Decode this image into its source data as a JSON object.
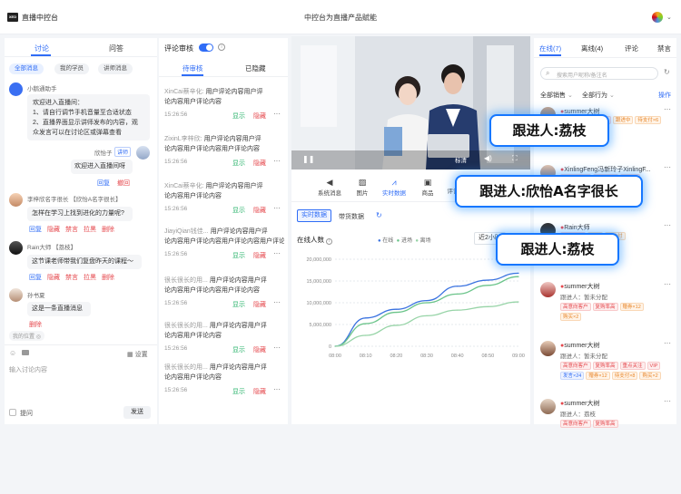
{
  "header": {
    "logo": "XED",
    "app_title": "直播中控台",
    "center_title": "中控台为直播产品赋能"
  },
  "left_panel": {
    "tabs": [
      {
        "label": "讨论"
      },
      {
        "label": "问答"
      }
    ],
    "filters": [
      {
        "label": "全部消息"
      },
      {
        "label": "我的学员"
      },
      {
        "label": "讲师消息"
      }
    ],
    "assistant": {
      "name": "小鹅通助手",
      "lines": [
        "欢迎进入直播间：",
        "1、请自行调节手机音量至合适状态",
        "2、直播界面显示讲师发布的内容，观",
        "众发言可以在讨论区或弹幕查看"
      ]
    },
    "self_msg": {
      "name": "欣怡子",
      "badge": "讲师",
      "text": "欢迎进入直播间呀",
      "actions": [
        "回复",
        "撤回"
      ]
    },
    "messages": [
      {
        "name": "李梓欣名字很长 【欣怡A名字很长】",
        "text": "怎样在学习上找到进化的力量呢?",
        "actions": [
          "回复",
          "隐藏",
          "禁言",
          "拉黑",
          "删除"
        ]
      },
      {
        "name": "Rain大师 【荔枝】",
        "text": "这节课老师带我们复盘昨天的课程～",
        "actions": [
          "回复",
          "隐藏",
          "禁言",
          "拉黑",
          "删除"
        ]
      },
      {
        "name": "孙书夏",
        "text": "这是一条直播消息",
        "actions": [
          "删除"
        ]
      }
    ],
    "my_position": "我的位置",
    "input_placeholder": "输入讨论内容",
    "settings_label": "设置",
    "prompt_label": "提问",
    "send_label": "发送"
  },
  "review_panel": {
    "title": "评论审核",
    "tabs": [
      {
        "label": "待审核"
      },
      {
        "label": "已隐藏"
      }
    ],
    "items": [
      {
        "name": "XinCai蔡辛化:",
        "text_a": "用户评论内容用户评",
        "text_b": "论内容用户评论内容",
        "time": "15:26:56",
        "show": "显示",
        "hide": "隐藏"
      },
      {
        "name": "ZixinL李梓欣:",
        "text_a": "用户评论内容用户评",
        "text_b": "论内容用户评论内容用户评论内容",
        "time": "15:26:56",
        "show": "显示",
        "hide": "隐藏"
      },
      {
        "name": "XinCai蔡辛化:",
        "text_a": "用户评论内容用户评",
        "text_b": "论内容用户评论内容",
        "time": "15:26:56",
        "show": "显示",
        "hide": "隐藏"
      },
      {
        "name": "JiayiQian钱佳...",
        "text_a": "用户评论内容用户评",
        "text_b": "论内容用户评论内容用户评论内容用户评论内容用户评论内容好呢？",
        "time": "15:26:56",
        "show": "显示",
        "hide": "隐藏"
      },
      {
        "name": "很长很长的用...",
        "text_a": "用户评论内容用户评",
        "text_b": "论内容用户评论内容用户评论内容",
        "time": "15:26:56",
        "show": "显示",
        "hide": "隐藏"
      },
      {
        "name": "很长很长的用...",
        "text_a": "用户评论内容用户评",
        "text_b": "论内容用户评论内容",
        "time": "15:26:56",
        "show": "显示",
        "hide": "隐藏"
      },
      {
        "name": "很长很长的用...",
        "text_a": "用户评论内容用户评",
        "text_b": "论内容用户评论内容",
        "time": "15:26:56",
        "show": "显示",
        "hide": "隐藏"
      }
    ]
  },
  "video": {
    "resolution": "标清"
  },
  "toolbar": {
    "items": [
      {
        "label": "系统消息"
      },
      {
        "label": "图片"
      },
      {
        "label": "实时数据"
      },
      {
        "label": "商品"
      },
      {
        "label": "评论"
      }
    ]
  },
  "data_tabs": [
    {
      "label": "实时数据"
    },
    {
      "label": "带货数据"
    }
  ],
  "chart_data": {
    "type": "line",
    "title": "在线人数",
    "legend": [
      "在线",
      "进场",
      "离场"
    ],
    "legend_position": "top-right",
    "range_label": "近2小时",
    "x": [
      "08:00",
      "08:10",
      "08:20",
      "08:30",
      "08:40",
      "08:50",
      "09:00"
    ],
    "y_ticks": [
      "20,000,000",
      "15,000,000",
      "10,000,000",
      "5,000,000",
      "0"
    ],
    "ylim": [
      0,
      20000000
    ],
    "series": [
      {
        "name": "在线",
        "color": "#3b73e0",
        "values": [
          0,
          6500000,
          8500000,
          10500000,
          13800000,
          15200000,
          16800000
        ]
      },
      {
        "name": "进场",
        "color": "#6bc48a",
        "values": [
          0,
          5200000,
          7800000,
          10000000,
          12000000,
          14000000,
          16000000
        ]
      },
      {
        "name": "离场",
        "color": "#97d4a7",
        "values": [
          0,
          2500000,
          4800000,
          7000000,
          8300000,
          9100000,
          10200000
        ]
      }
    ],
    "grid": true
  },
  "right_panel": {
    "tabs": [
      {
        "label": "在线(7)"
      },
      {
        "label": "离线(4)"
      },
      {
        "label": "评论"
      },
      {
        "label": "禁言"
      }
    ],
    "search_placeholder": "搜索用户昵称/备注名",
    "filter_sales": "全部销售",
    "filter_all": "全部行为",
    "operate_label": "操作",
    "users": [
      {
        "name": "summer大树",
        "sub": "",
        "tags": [
          [
            "重点关注",
            "red"
          ],
          [
            "VIP客户",
            "red"
          ],
          [
            "跟进中",
            "orange"
          ],
          [
            "待支付×6",
            "orange"
          ],
          [
            "购买×2",
            "orange"
          ]
        ]
      },
      {
        "name": "XinlingFeng冯新玲子XinlingF...",
        "sub": "",
        "tags": [
          [
            "高意向客户",
            "red"
          ],
          [
            "发起询价",
            "red"
          ],
          [
            "未付款",
            "red"
          ],
          [
            "复购率高",
            "orange"
          ]
        ]
      },
      {
        "name": "Rain大师",
        "sub": "",
        "tags": [
          [
            "重点关注",
            "red"
          ],
          [
            "复购",
            "orange"
          ],
          [
            "待支付",
            "orange"
          ]
        ]
      },
      {
        "name": "summer大树",
        "sub": "跟进人：暂未分配",
        "tags": [
          [
            "高意向客户",
            "red"
          ],
          [
            "复购率高",
            "red"
          ],
          [
            "赠券×12",
            "orange"
          ],
          [
            "购买×2",
            "orange"
          ]
        ]
      },
      {
        "name": "summer大树",
        "sub": "跟进人：暂未分配",
        "tags": [
          [
            "高意向客户",
            "red"
          ],
          [
            "复购率高",
            "red"
          ],
          [
            "重点关注",
            "red"
          ],
          [
            "VIP",
            "red"
          ],
          [
            "发言×24",
            "blue"
          ],
          [
            "赠券×12",
            "orange"
          ],
          [
            "待支付×8",
            "orange"
          ],
          [
            "购买×2",
            "orange"
          ]
        ]
      },
      {
        "name": "summer大树",
        "sub": "跟进人：荔枝",
        "tags": [
          [
            "高意向客户",
            "red"
          ],
          [
            "复购率高",
            "red"
          ]
        ]
      }
    ]
  },
  "callouts": [
    {
      "text": "跟进人:荔枝"
    },
    {
      "text": "跟进人:欣怡A名字很长"
    },
    {
      "text": "跟进人:荔枝"
    }
  ]
}
